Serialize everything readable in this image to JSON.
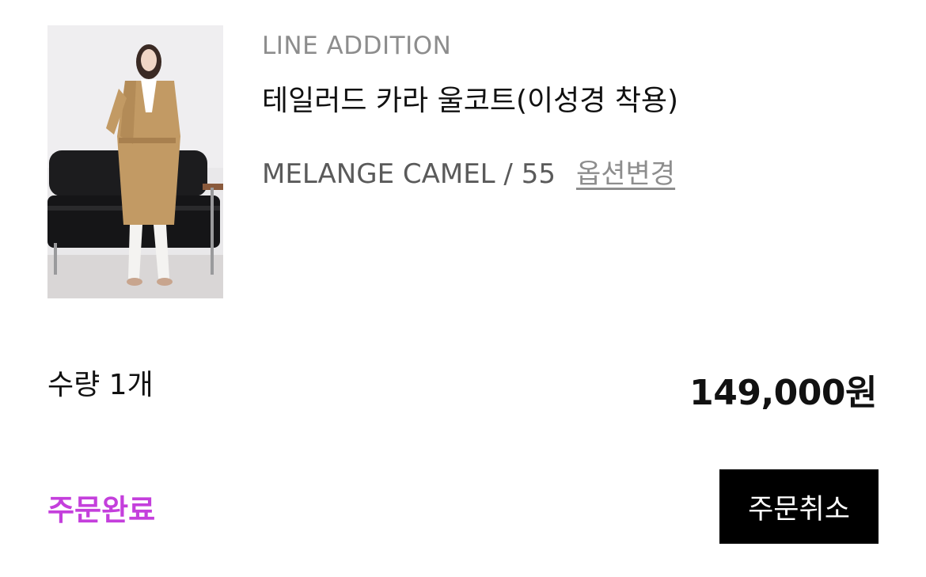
{
  "product": {
    "brand": "LINE ADDITION",
    "name": "테일러드 카라 울코트(이성경 착용)",
    "option": "MELANGE CAMEL / 55",
    "option_change_label": "옵션변경",
    "quantity": "수량 1개",
    "price": "149,000원",
    "image_icon": "product-photo-model-in-camel-coat"
  },
  "order": {
    "status": "주문완료",
    "status_color": "#c43fdc",
    "cancel_label": "주문취소"
  }
}
